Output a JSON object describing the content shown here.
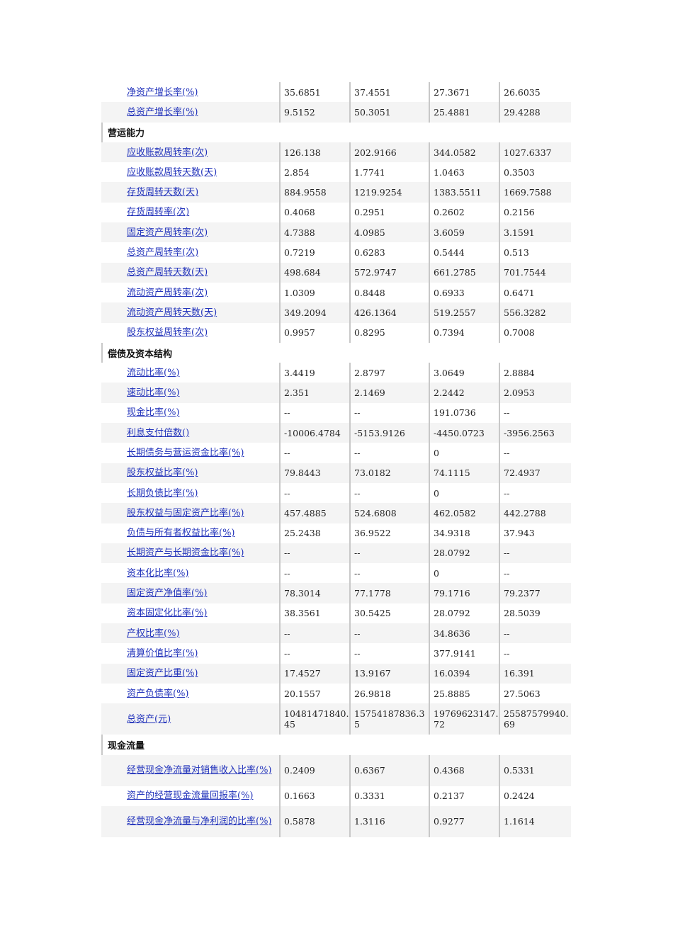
{
  "rows": [
    {
      "type": "data",
      "label": "净资产增长率(%)",
      "values": [
        "35.6851",
        "37.4551",
        "27.3671",
        "26.6035"
      ]
    },
    {
      "type": "data",
      "label": "总资产增长率(%)",
      "values": [
        "9.5152",
        "50.3051",
        "25.4881",
        "29.4288"
      ]
    },
    {
      "type": "section",
      "label": "营运能力"
    },
    {
      "type": "data",
      "label": "应收账款周转率(次)",
      "values": [
        "126.138",
        "202.9166",
        "344.0582",
        "1027.6337"
      ]
    },
    {
      "type": "data",
      "label": "应收账款周转天数(天)",
      "values": [
        "2.854",
        "1.7741",
        "1.0463",
        "0.3503"
      ]
    },
    {
      "type": "data",
      "label": "存货周转天数(天)",
      "values": [
        "884.9558",
        "1219.9254",
        "1383.5511",
        "1669.7588"
      ]
    },
    {
      "type": "data",
      "label": "存货周转率(次)",
      "values": [
        "0.4068",
        "0.2951",
        "0.2602",
        "0.2156"
      ]
    },
    {
      "type": "data",
      "label": "固定资产周转率(次)",
      "values": [
        "4.7388",
        "4.0985",
        "3.6059",
        "3.1591"
      ]
    },
    {
      "type": "data",
      "label": "总资产周转率(次)",
      "values": [
        "0.7219",
        "0.6283",
        "0.5444",
        "0.513"
      ]
    },
    {
      "type": "data",
      "label": "总资产周转天数(天)",
      "values": [
        "498.684",
        "572.9747",
        "661.2785",
        "701.7544"
      ]
    },
    {
      "type": "data",
      "label": "流动资产周转率(次)",
      "values": [
        "1.0309",
        "0.8448",
        "0.6933",
        "0.6471"
      ]
    },
    {
      "type": "data",
      "label": "流动资产周转天数(天)",
      "values": [
        "349.2094",
        "426.1364",
        "519.2557",
        "556.3282"
      ]
    },
    {
      "type": "data",
      "label": "股东权益周转率(次)",
      "values": [
        "0.9957",
        "0.8295",
        "0.7394",
        "0.7008"
      ]
    },
    {
      "type": "section",
      "label": "偿债及资本结构"
    },
    {
      "type": "data",
      "label": "流动比率(%)",
      "values": [
        "3.4419",
        "2.8797",
        "3.0649",
        "2.8884"
      ]
    },
    {
      "type": "data",
      "label": "速动比率(%)",
      "values": [
        "2.351",
        "2.1469",
        "2.2442",
        "2.0953"
      ]
    },
    {
      "type": "data",
      "label": "现金比率(%)",
      "values": [
        "--",
        "--",
        "191.0736",
        "--"
      ]
    },
    {
      "type": "data",
      "label": "利息支付倍数()",
      "values": [
        "-10006.4784",
        "-5153.9126",
        "-4450.0723",
        "-3956.2563"
      ]
    },
    {
      "type": "data",
      "label": "长期债务与营运资金比率(%)",
      "values": [
        "--",
        "--",
        "0",
        "--"
      ]
    },
    {
      "type": "data",
      "label": "股东权益比率(%)",
      "values": [
        "79.8443",
        "73.0182",
        "74.1115",
        "72.4937"
      ]
    },
    {
      "type": "data",
      "label": "长期负债比率(%)",
      "values": [
        "--",
        "--",
        "0",
        "--"
      ]
    },
    {
      "type": "data",
      "label": "股东权益与固定资产比率(%)",
      "values": [
        "457.4885",
        "524.6808",
        "462.0582",
        "442.2788"
      ]
    },
    {
      "type": "data",
      "label": "负债与所有者权益比率(%)",
      "values": [
        "25.2438",
        "36.9522",
        "34.9318",
        "37.943"
      ]
    },
    {
      "type": "data",
      "label": "长期资产与长期资金比率(%)",
      "values": [
        "--",
        "--",
        "28.0792",
        "--"
      ]
    },
    {
      "type": "data",
      "label": "资本化比率(%)",
      "values": [
        "--",
        "--",
        "0",
        "--"
      ]
    },
    {
      "type": "data",
      "label": "固定资产净值率(%)",
      "values": [
        "78.3014",
        "77.1778",
        "79.1716",
        "79.2377"
      ]
    },
    {
      "type": "data",
      "label": "资本固定化比率(%)",
      "values": [
        "38.3561",
        "30.5425",
        "28.0792",
        "28.5039"
      ]
    },
    {
      "type": "data",
      "label": "产权比率(%)",
      "values": [
        "--",
        "--",
        "34.8636",
        "--"
      ]
    },
    {
      "type": "data",
      "label": "清算价值比率(%)",
      "values": [
        "--",
        "--",
        "377.9141",
        "--"
      ]
    },
    {
      "type": "data",
      "label": "固定资产比重(%)",
      "values": [
        "17.4527",
        "13.9167",
        "16.0394",
        "16.391"
      ]
    },
    {
      "type": "data",
      "label": "资产负债率(%)",
      "values": [
        "20.1557",
        "26.9818",
        "25.8885",
        "27.5063"
      ]
    },
    {
      "type": "data",
      "tall": true,
      "label": "总资产(元)",
      "values": [
        "10481471840.45",
        "15754187836.35",
        "19769623147.72",
        "25587579940.69"
      ]
    },
    {
      "type": "section",
      "label": "现金流量"
    },
    {
      "type": "data",
      "tall": true,
      "label": "经营现金净流量对销售收入比率(%)",
      "values": [
        "0.2409",
        "0.6367",
        "0.4368",
        "0.5331"
      ]
    },
    {
      "type": "data",
      "label": "资产的经营现金流量回报率(%)",
      "values": [
        "0.1663",
        "0.3331",
        "0.2137",
        "0.2424"
      ]
    },
    {
      "type": "data",
      "tall": true,
      "label": "经营现金净流量与净利润的比率(%)",
      "values": [
        "0.5878",
        "1.3116",
        "0.9277",
        "1.1614"
      ]
    }
  ]
}
